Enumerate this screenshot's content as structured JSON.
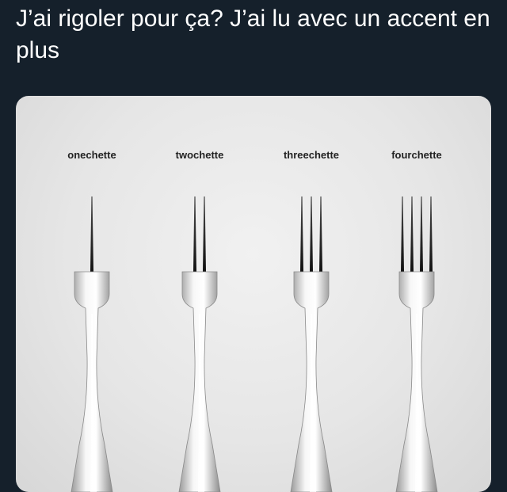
{
  "tweet": {
    "text": "J’ai rigoler pour ça? J’ai lu avec un accent en plus"
  },
  "image": {
    "labels": [
      "onechette",
      "twochette",
      "threechette",
      "fourchette"
    ],
    "tines": [
      1,
      2,
      3,
      4
    ]
  }
}
